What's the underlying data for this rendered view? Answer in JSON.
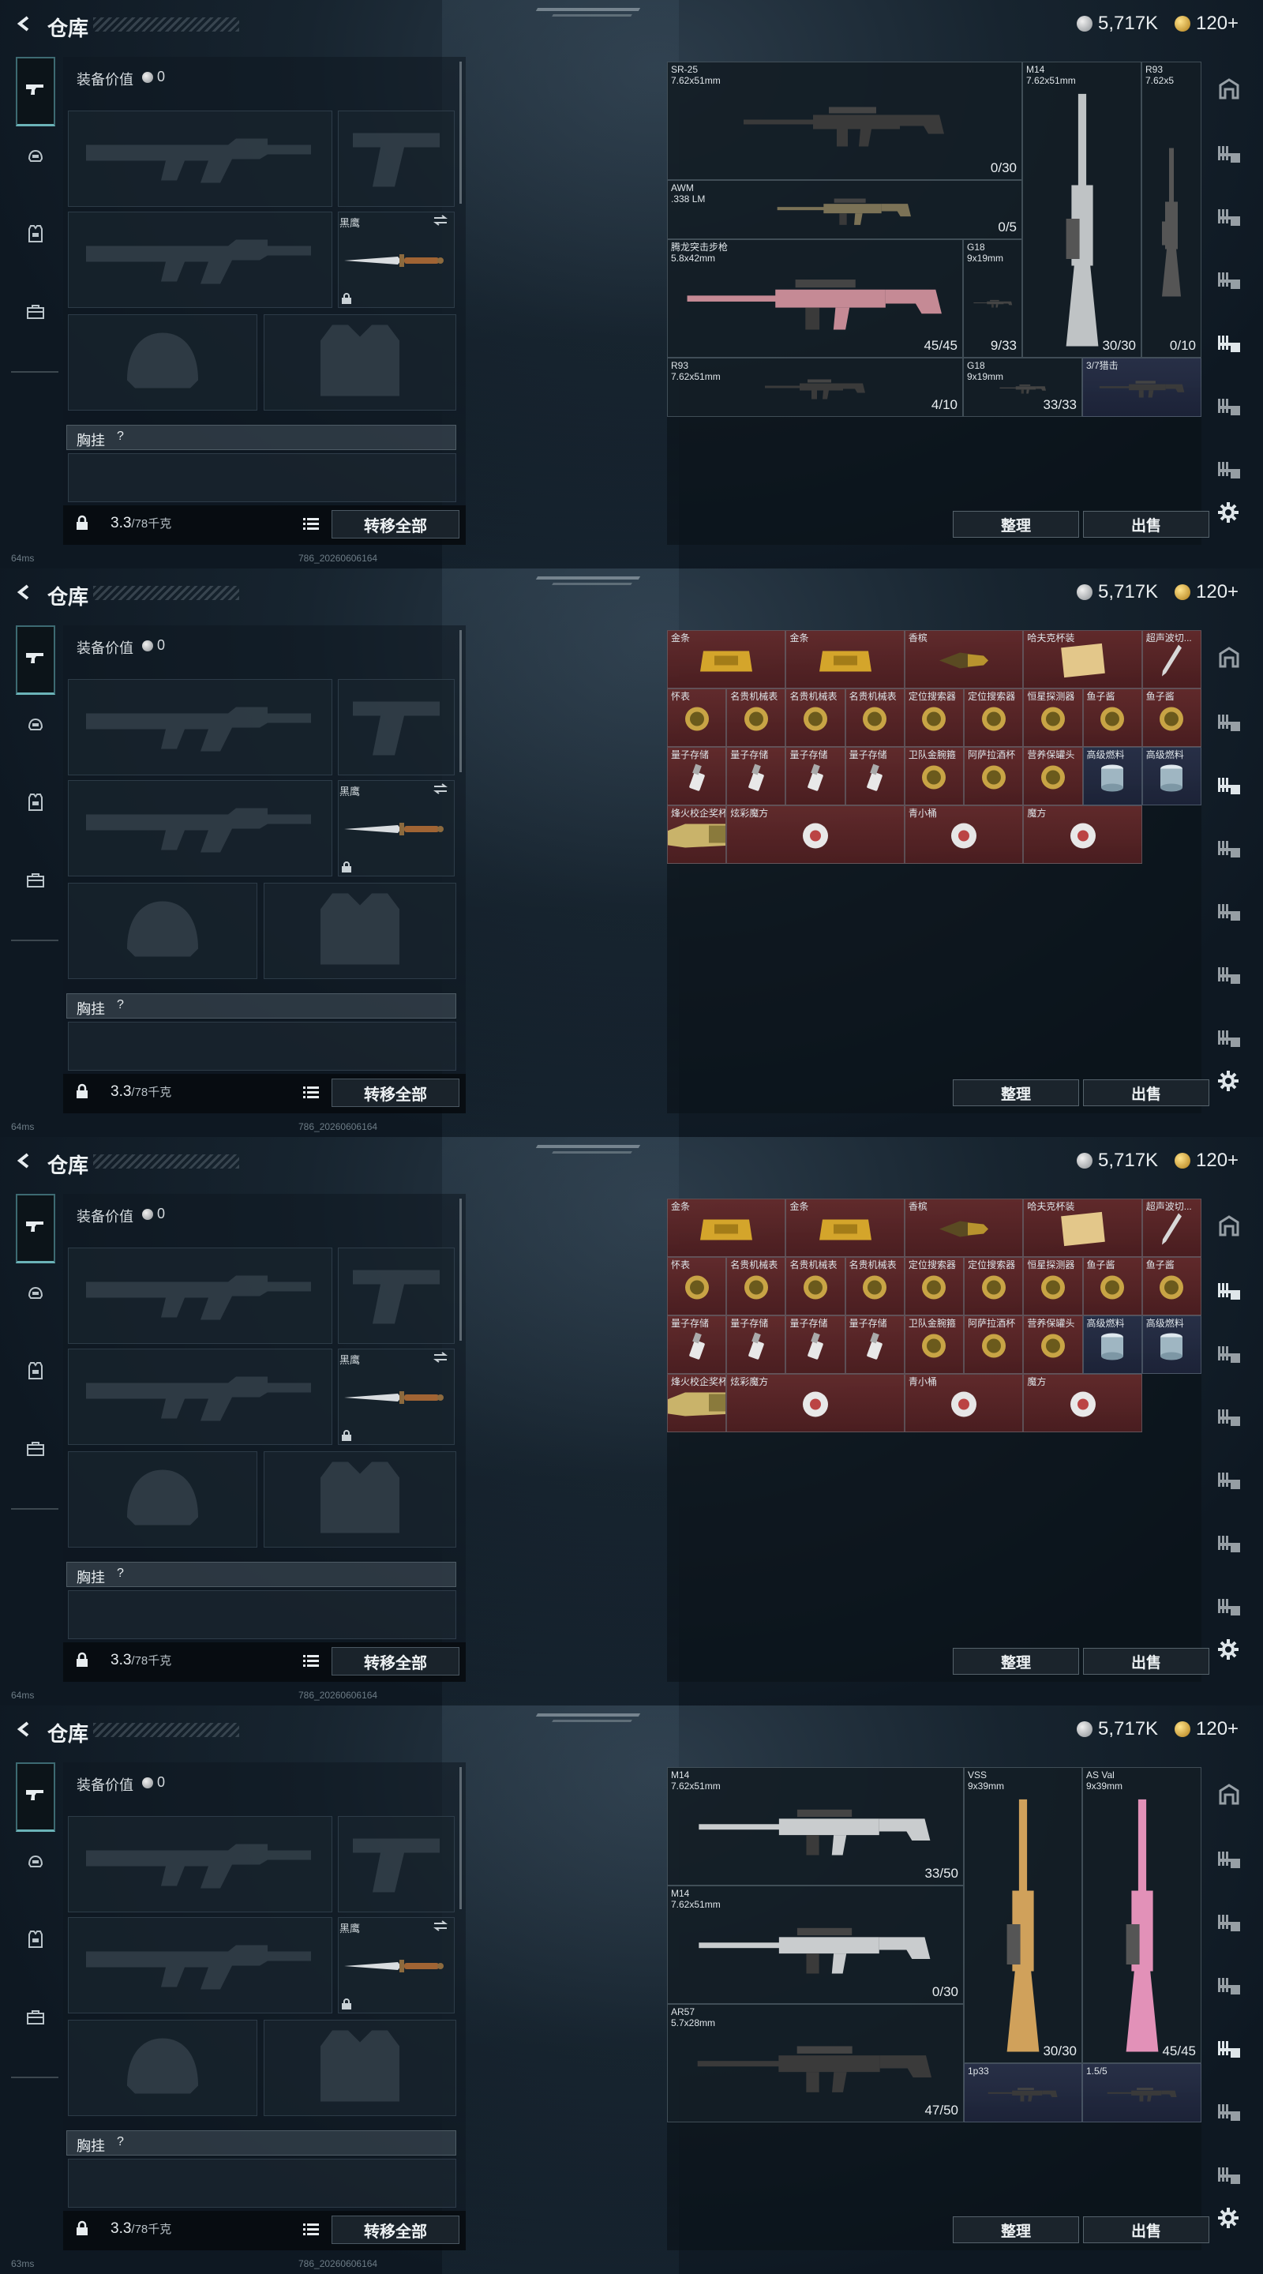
{
  "common": {
    "title": "仓库",
    "silver": "5,717K",
    "gold": "120+",
    "equip_label": "装备价值",
    "equip_value": "0",
    "knife_name": "黑鹰",
    "chest_label": "胸挂",
    "chest_q": "?",
    "weight": "3.3",
    "weight_max": "/78千克",
    "transfer_all": "转移全部",
    "sort": "整理",
    "sell": "出售",
    "build": "786_20260606164"
  },
  "panels": [
    {
      "ping": "64ms",
      "items": [
        {
          "n": "SR-25\n7.62x51mm",
          "c": "0/30"
        },
        {
          "n": "M14\n7.62x51mm",
          "c": "30/30"
        },
        {
          "n": "R93\n7.62x5",
          "c": "0/10"
        },
        {
          "n": "AWM\n.338 LM",
          "c": "0/5"
        },
        {
          "n": "腾龙突击步枪\n5.8x42mm",
          "c": "45/45"
        },
        {
          "n": "G18\n9x19mm",
          "c": "9/33"
        },
        {
          "n": "R93\n7.62x51mm",
          "c": "4/10"
        },
        {
          "n": "G18\n9x19mm",
          "c": "33/33"
        },
        {
          "n": "3/7猎击",
          "c": ""
        }
      ]
    },
    {
      "ping": "64ms",
      "items": [
        "金条",
        "金条",
        "香槟",
        "哈夫克杯装",
        "超声波切...",
        "怀表",
        "名贵机械表",
        "名贵机械表",
        "名贵机械表",
        "定位搜索器",
        "定位搜索器",
        "恒星探测器",
        "鱼子酱",
        "鱼子酱",
        "量子存储",
        "量子存储",
        "量子存储",
        "量子存储",
        "卫队金腕箍",
        "阿萨拉酒杯",
        "营养保罐头",
        "高级燃料",
        "高级燃料",
        "烽火校企奖杯",
        "炫彩魔方",
        "青小桶",
        "魔方"
      ]
    },
    {
      "ping": "64ms",
      "items": [
        "金条",
        "金条",
        "香槟",
        "哈夫克杯装",
        "超声波切...",
        "怀表",
        "名贵机械表",
        "名贵机械表",
        "名贵机械表",
        "定位搜索器",
        "定位搜索器",
        "恒星探测器",
        "鱼子酱",
        "鱼子酱",
        "量子存储",
        "量子存储",
        "量子存储",
        "量子存储",
        "卫队金腕箍",
        "阿萨拉酒杯",
        "营养保罐头",
        "高级燃料",
        "高级燃料",
        "烽火校企奖杯",
        "炫彩魔方",
        "青小桶",
        "魔方"
      ]
    },
    {
      "ping": "63ms",
      "items": [
        {
          "n": "M14\n7.62x51mm",
          "c": "33/50"
        },
        {
          "n": "VSS\n9x39mm",
          "c": "30/30"
        },
        {
          "n": "AS Val\n9x39mm",
          "c": "45/45"
        },
        {
          "n": "M14\n7.62x51mm",
          "c": "0/30"
        },
        {
          "n": "AR57\n5.7x28mm",
          "c": "47/50"
        },
        {
          "n": "1p33",
          "c": ""
        },
        {
          "n": "1.5/5",
          "c": ""
        }
      ]
    }
  ],
  "colors": {
    "accent": "#6bb3b8",
    "red_item": "#6e2d2d",
    "blue_item": "#2c344e"
  }
}
